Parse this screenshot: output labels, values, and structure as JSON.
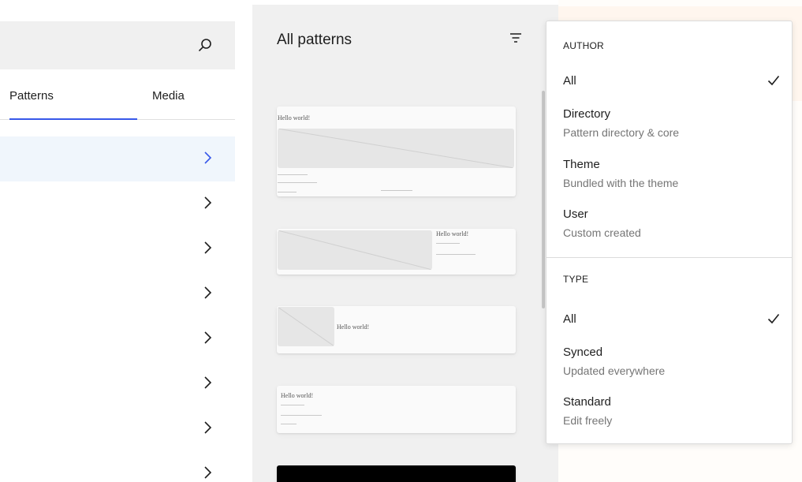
{
  "tabs": {
    "patterns": "Patterns",
    "media": "Media"
  },
  "categories": {
    "count": 8,
    "active_index": 0
  },
  "patterns_panel": {
    "title": "All patterns",
    "previews": [
      {
        "title": "Hello world!"
      },
      {
        "title": "Hello world!"
      },
      {
        "title": "Hello world!"
      },
      {
        "title": "Hello world!"
      }
    ]
  },
  "filter": {
    "author_heading": "AUTHOR",
    "author_options": [
      {
        "label": "All",
        "description": "",
        "selected": true
      },
      {
        "label": "Directory",
        "description": "Pattern directory & core",
        "selected": false
      },
      {
        "label": "Theme",
        "description": "Bundled with the theme",
        "selected": false
      },
      {
        "label": "User",
        "description": "Custom created",
        "selected": false
      }
    ],
    "type_heading": "TYPE",
    "type_options": [
      {
        "label": "All",
        "description": "",
        "selected": true
      },
      {
        "label": "Synced",
        "description": "Updated everywhere",
        "selected": false
      },
      {
        "label": "Standard",
        "description": "Edit freely",
        "selected": false
      }
    ]
  },
  "icons": {
    "search": "search-icon",
    "chevron": "chevron-right-icon",
    "filter": "filter-icon",
    "check": "check-icon"
  },
  "colors": {
    "accent": "#3858e9",
    "active_bg": "#f0f6fc",
    "panel_bg": "#f0f0f0"
  }
}
